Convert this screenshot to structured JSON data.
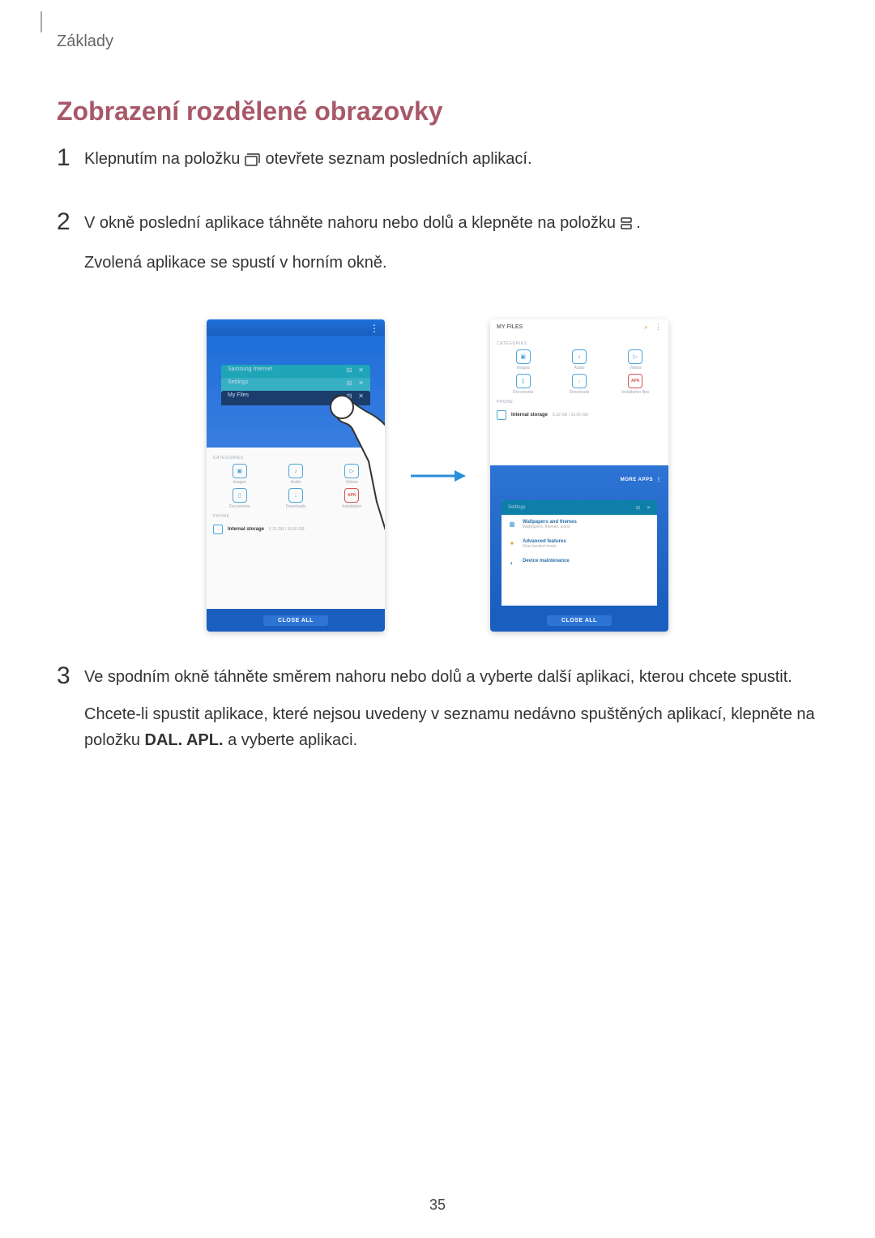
{
  "breadcrumb": "Základy",
  "section_title": "Zobrazení rozdělené obrazovky",
  "steps": {
    "s1": {
      "num": "1",
      "part1": "Klepnutím na položku ",
      "part2": " otevřete seznam posledních aplikací."
    },
    "s2": {
      "num": "2",
      "part1": "V okně poslední aplikace táhněte nahoru nebo dolů a klepněte na položku ",
      "part2": ".",
      "line2": "Zvolená aplikace se spustí v horním okně."
    },
    "s3": {
      "num": "3",
      "line1": "Ve spodním okně táhněte směrem nahoru nebo dolů a vyberte další aplikaci, kterou chcete spustit.",
      "line2a": "Chcete-li spustit aplikace, které nejsou uvedeny v seznamu nedávno spuštěných aplikací, klepněte na položku ",
      "line2_strong": "DAL. APL.",
      "line2b": " a vyberte aplikaci."
    }
  },
  "figure": {
    "left": {
      "recent_cards": {
        "c1_label": "Samsung Internet",
        "c2_label": "Settings",
        "c3_label": "My Files"
      },
      "categories_label": "CATEGORIES",
      "grid": {
        "images": "Images",
        "audio": "Audio",
        "videos": "Videos",
        "documents": "Documents",
        "downloads": "Downloads",
        "install": "Installation"
      },
      "phone_label": "PHONE",
      "internal": "Internal storage",
      "internal_sub": "6.31 GB / 16.00 GB",
      "close_all": "CLOSE ALL",
      "apk": "APK"
    },
    "right": {
      "top_title": "MY FILES",
      "categories_label": "CATEGORIES",
      "grid": {
        "images": "Images",
        "audio": "Audio",
        "videos": "Videos",
        "documents": "Documents",
        "downloads": "Downloads",
        "install": "Installation files"
      },
      "phone_label": "PHONE",
      "internal": "Internal storage",
      "internal_sub": "6.32 GB / 16.00 GB",
      "more_apps": "MORE APPS",
      "settings_card_label": "Settings",
      "list1_title": "Wallpapers and themes",
      "list1_sub": "Wallpapers, themes, icons",
      "list2_title": "Advanced features",
      "list2_sub": "One-handed mode",
      "list3_title": "Device maintenance",
      "close_all": "CLOSE ALL",
      "apk": "APK"
    }
  },
  "page_number": "35"
}
